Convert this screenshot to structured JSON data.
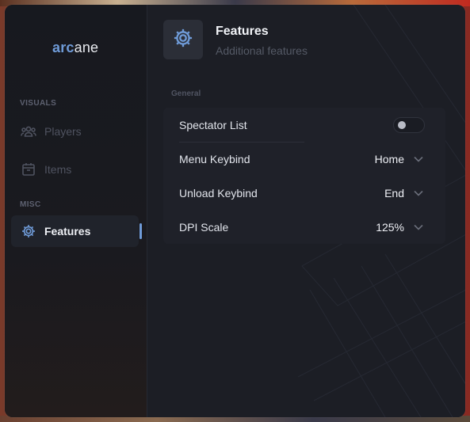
{
  "app": {
    "logo_part1": "arc",
    "logo_part2": "ane",
    "accent_color": "#6f9bd8"
  },
  "sidebar": {
    "sections": [
      {
        "label": "VISUALS",
        "items": [
          {
            "label": "Players",
            "icon": "users-icon",
            "active": false
          },
          {
            "label": "Items",
            "icon": "box-icon",
            "active": false
          }
        ]
      },
      {
        "label": "MISC",
        "items": [
          {
            "label": "Features",
            "icon": "gear-icon",
            "active": true
          }
        ]
      }
    ]
  },
  "header": {
    "icon": "gear-icon",
    "title": "Features",
    "subtitle": "Additional features"
  },
  "general": {
    "label": "General",
    "settings": [
      {
        "label": "Spectator List",
        "type": "toggle",
        "value": false
      },
      {
        "label": "Menu Keybind",
        "type": "select",
        "value": "Home"
      },
      {
        "label": "Unload Keybind",
        "type": "select",
        "value": "End"
      },
      {
        "label": "DPI Scale",
        "type": "select",
        "value": "125%"
      }
    ]
  }
}
